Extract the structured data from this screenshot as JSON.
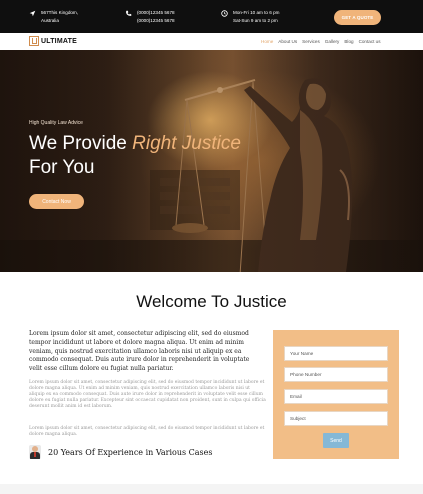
{
  "topbar": {
    "address_line1": "567This Kingdom,",
    "address_line2": "Australia",
    "phone_line1": "(0000)12345 5678",
    "phone_line2": "(0000)12345 5678",
    "hours_line1": "Mon-Fri 10 am to 6 pm",
    "hours_line2": "Sat-Sun 9 am to 2 pm",
    "quote_button": "GET A QUOTE"
  },
  "navbar": {
    "logo_text": "ULTIMATE",
    "links": [
      "Home",
      "About Us",
      "Services",
      "Gallery",
      "Blog",
      "Contact us"
    ]
  },
  "hero": {
    "subtitle": "High Quality Law Advice",
    "title_part1": "We Provide ",
    "title_highlight": "Right Justice",
    "title_part2": "For You",
    "button": "Contact Now"
  },
  "welcome": {
    "title": "Welcome To Justice",
    "intro": "Lorem ipsum dolor sit amet, consectetur adipiscing elit, sed do eiusmod tempor incididunt ut labore et dolore magna aliqua. Ut enim ad minim veniam, quis nostrud exercitation ullamco laboris nisi ut aliquip ex ea commodo consequat. Duis aute irure dolor in reprehenderit in voluptate velit esse cillum dolore eu fugiat nulla pariatur.",
    "paragraph1": "Lorem ipsum dolor sit amet, consectetur adipiscing elit, sed do eiusmod tempor incididunt ut labore et dolore magna aliqua. Ut enim ad minim veniam, quis nostrud exercitation ullamco laboris nisi ut aliquip ex ea commodo consequat. Duis aute irure dolor in reprehenderit in voluptate velit esse cillum dolore eu fugiat nulla pariatur. Excepteur sint occaecat cupidatat non proident, sunt in culpa qui officia deserunt mollit anim id est laborum.",
    "paragraph2": "Lorem ipsum dolor sit amet, consectetur adipiscing elit, sed do eiusmod tempor incididunt ut labore et dolore magna aliqua.",
    "experience": "20 Years Of Experience in Various Cases"
  },
  "form": {
    "name_placeholder": "Your Name",
    "phone_placeholder": "Phone Number",
    "email_placeholder": "Email",
    "subject_placeholder": "Subject",
    "send_button": "Send"
  },
  "colors": {
    "accent": "#f0b47a",
    "topbar_bg": "#0f0f0f",
    "send_button": "#85b8d6"
  }
}
